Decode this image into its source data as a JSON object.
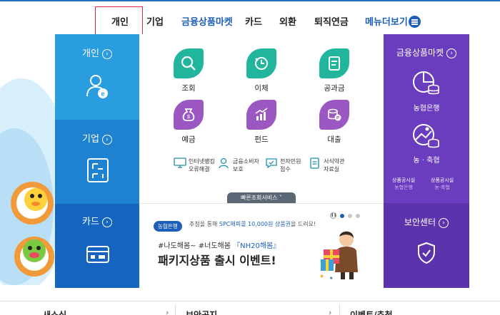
{
  "nav": {
    "items": [
      {
        "label": "개인",
        "blue": false
      },
      {
        "label": "기업",
        "blue": false
      },
      {
        "label": "금융상품마켓",
        "blue": true
      },
      {
        "label": "카드",
        "blue": false
      },
      {
        "label": "외환",
        "blue": false
      },
      {
        "label": "퇴직연금",
        "blue": false
      },
      {
        "label": "메뉴더보기",
        "blue": true
      }
    ],
    "selected_index": 0
  },
  "left": {
    "personal": "개인",
    "corporate": "기업",
    "card": "카드",
    "arrow": "›"
  },
  "tiles": [
    {
      "label": "조회",
      "color": "green",
      "icon": "search-icon"
    },
    {
      "label": "이체",
      "color": "green",
      "icon": "transfer-icon"
    },
    {
      "label": "공과금",
      "color": "green",
      "icon": "bill-icon"
    },
    {
      "label": "예금",
      "color": "purple",
      "icon": "money-bag-icon"
    },
    {
      "label": "펀드",
      "color": "purple",
      "icon": "chart-icon"
    },
    {
      "label": "대출",
      "color": "purple",
      "icon": "coins-icon"
    }
  ],
  "mini": [
    {
      "line1": "인터넷뱅킹",
      "line2": "오류해결"
    },
    {
      "line1": "금융소비자",
      "line2": "보호"
    },
    {
      "line1": "전자민원",
      "line2": "접수"
    },
    {
      "line1": "서식약관",
      "line2": "자료실"
    }
  ],
  "quick_tab": "빠른조회서비스 ˅",
  "banner": {
    "badge": "농협은행",
    "note_prefix": "추첨을 통해 ",
    "note_highlight": "SPC해피콜 10,000원 상품권",
    "note_suffix": "을 드려요!",
    "sub_prefix": "#나도해봄~ #너도해봄 ",
    "sub_highlight": "『NH20해봄』",
    "main": "패키지상품 출시 이벤트!"
  },
  "right": {
    "market": "금융상품마켓",
    "bank_label": "농협은행",
    "coop_label": "농 · 축협",
    "disclosure1_l1": "상품공시실",
    "disclosure1_l2": "농협은행",
    "disclosure2_l1": "상품공시실",
    "disclosure2_l2": "농·축협",
    "security": "보안센터"
  },
  "bottom": {
    "c1": "새소식",
    "c2": "보안공지",
    "c3": "이벤트/추첨"
  },
  "colors": {
    "blue_top": "#2a9de0",
    "blue_mid": "#1e82d0",
    "blue_bot": "#1565c0",
    "purple": "#6a3dbf",
    "green": "#21b59d",
    "accent": "#1d5fb8",
    "selection": "#e0263a"
  }
}
